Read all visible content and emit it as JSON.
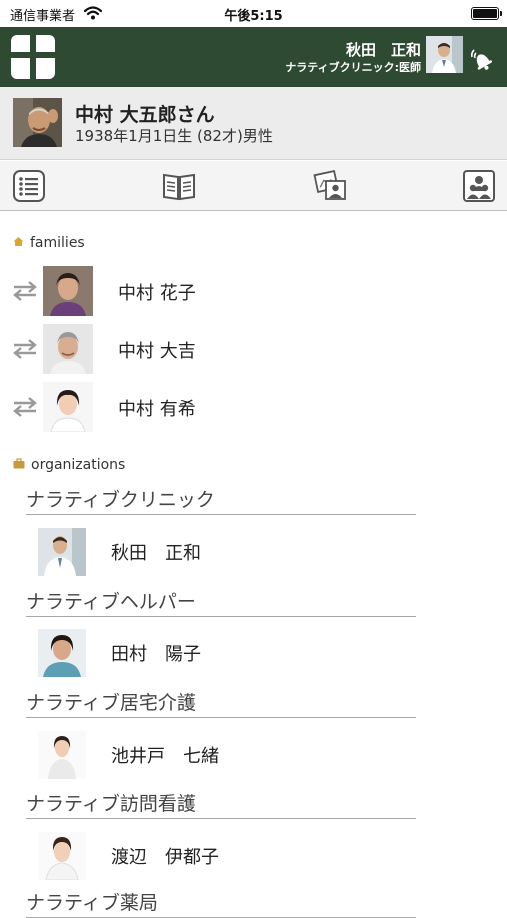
{
  "status_bar": {
    "carrier": "通信事業者",
    "time": "午後5:15"
  },
  "header": {
    "user_name": "秋田　正和",
    "user_org": "ナラティブクリニック:医師",
    "logo_icon": "app-logo-icon",
    "notify_icon": "bell-icon",
    "brand_color": "#2f4a33"
  },
  "patient": {
    "name": "中村 大五郎さん",
    "info": "1938年1月1日生 (82才)男性"
  },
  "toolbar": {
    "items": [
      {
        "icon": "list-icon"
      },
      {
        "icon": "book-icon"
      },
      {
        "icon": "photo-people-icon"
      },
      {
        "icon": "team-icon"
      }
    ]
  },
  "families": {
    "title": "families",
    "members": [
      {
        "name": "中村 花子"
      },
      {
        "name": "中村 大吉"
      },
      {
        "name": "中村 有希"
      }
    ]
  },
  "organizations": {
    "title": "organizations",
    "items": [
      {
        "name": "ナラティブクリニック",
        "member": "秋田　正和"
      },
      {
        "name": "ナラティブヘルパー",
        "member": "田村　陽子"
      },
      {
        "name": "ナラティブ居宅介護",
        "member": "池井戸　七緒"
      },
      {
        "name": "ナラティブ訪問看護",
        "member": "渡辺　伊都子"
      },
      {
        "name": "ナラティブ薬局"
      }
    ]
  }
}
